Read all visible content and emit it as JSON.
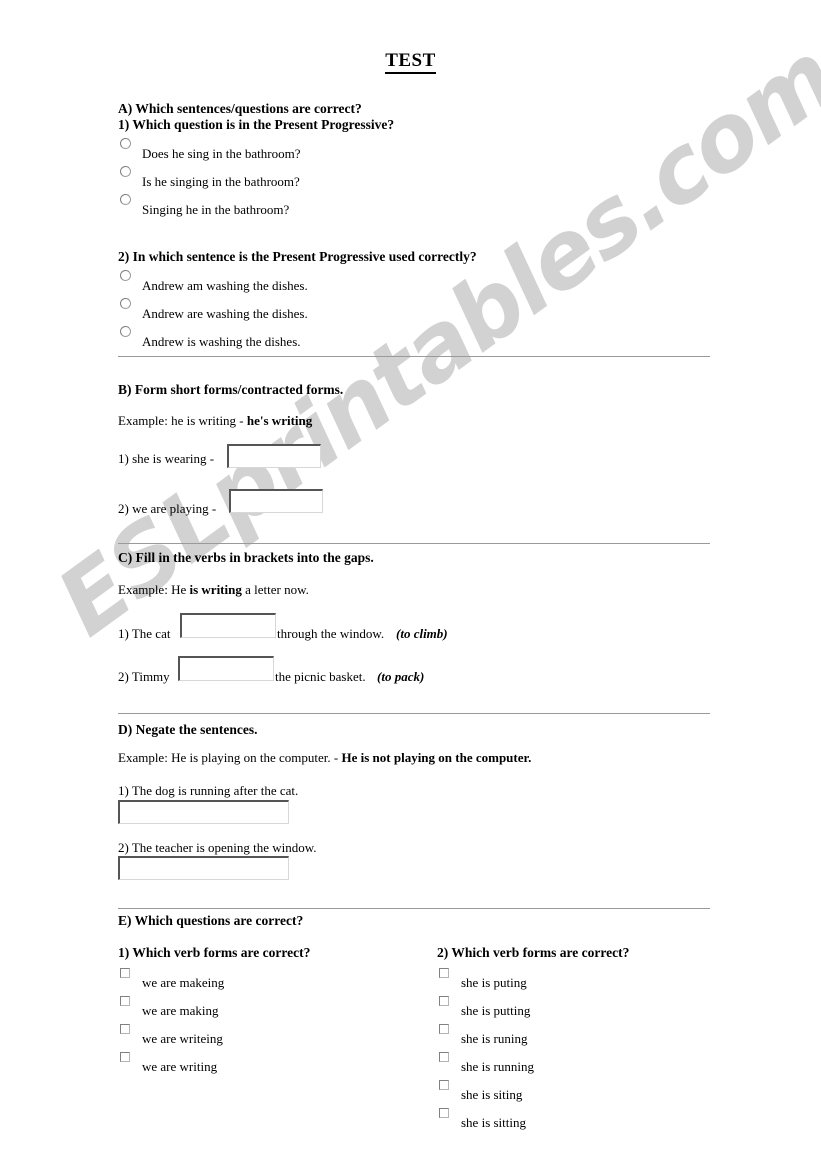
{
  "document": {
    "title": "TEST",
    "watermark": "ESLprintables.com"
  },
  "sections": {
    "a": {
      "heading": "A) Which sentences/questions are correct?",
      "q1": {
        "heading": "1) Which question is in the Present Progressive?",
        "options": [
          "Does he sing in the bathroom?",
          "Is he singing in the bathroom?",
          "Singing he in the bathroom?"
        ]
      },
      "q2": {
        "heading": "2) In which sentence is the Present Progressive used correctly?",
        "options": [
          "Andrew am washing the dishes.",
          "Andrew are washing the dishes.",
          "Andrew is washing the dishes."
        ]
      }
    },
    "b": {
      "heading": "B) Form short forms/contracted forms.",
      "example_prefix": "Example: he is writing - ",
      "example_answer": "he's writing",
      "items": [
        {
          "prompt": "1) she is wearing -",
          "value": ""
        },
        {
          "prompt": "2) we are playing -",
          "value": ""
        }
      ]
    },
    "c": {
      "heading": "C) Fill in the verbs in brackets into the gaps.",
      "example_prefix": "Example: He ",
      "example_bold": "is writing",
      "example_suffix": " a letter now.",
      "items": [
        {
          "before": "1) The cat",
          "value": "",
          "after": "through the window.",
          "hint": "(to climb)"
        },
        {
          "before": "2) Timmy",
          "value": "",
          "after": "the picnic basket.",
          "hint": "(to pack)"
        }
      ]
    },
    "d": {
      "heading": "D) Negate the sentences.",
      "example_prefix": "Example: He is playing on the computer. - ",
      "example_answer": "He is not playing on the computer.",
      "items": [
        {
          "prompt": "1) The dog is running after the cat.",
          "value": ""
        },
        {
          "prompt": "2) The teacher is opening the window.",
          "value": ""
        }
      ]
    },
    "e": {
      "heading": "E) Which questions are correct?",
      "q1": {
        "heading": "1) Which verb forms are correct?",
        "options": [
          "we are makeing",
          "we are making",
          "we are writeing",
          "we are writing"
        ]
      },
      "q2": {
        "heading": "2) Which verb forms are correct?",
        "options": [
          "she is puting",
          "she is putting",
          "she is runing",
          "she is running",
          "she is siting",
          "she is sitting"
        ]
      }
    }
  }
}
